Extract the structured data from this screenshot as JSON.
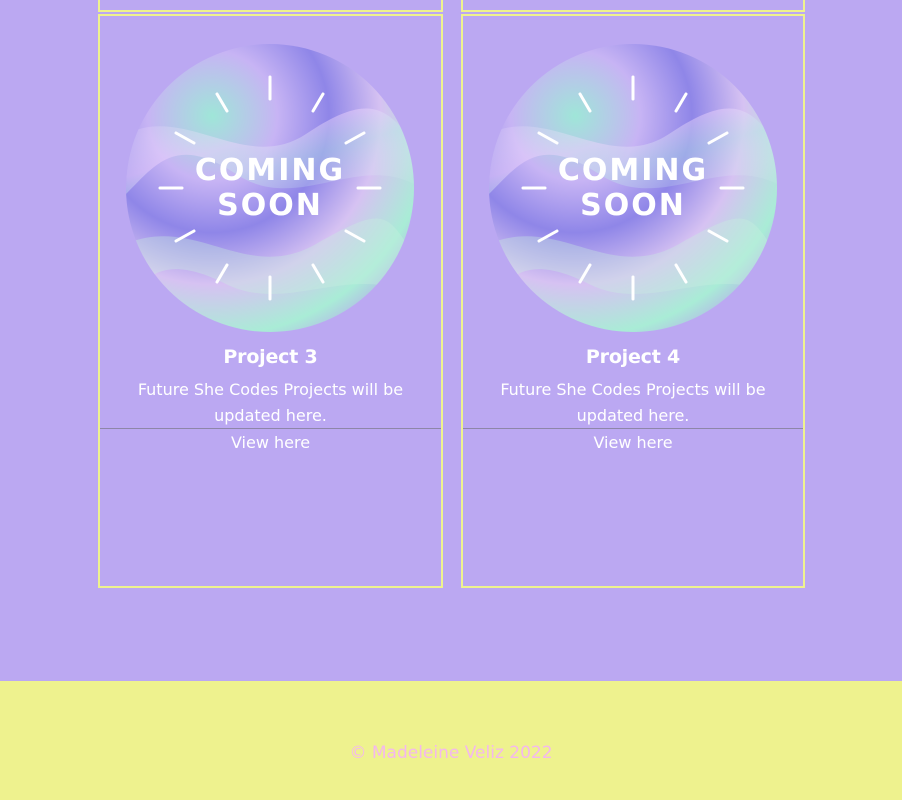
{
  "colors": {
    "background": "#bba8f2",
    "card_border": "#eef28e",
    "footer_background": "#eef28e",
    "footer_text": "#f4b8ee",
    "text": "#ffffff"
  },
  "projects": [
    {
      "image_text_line1": "COMING",
      "image_text_line2": "SOON",
      "title": "Project 3",
      "description": "Future She Codes Projects will be updated here.",
      "link_label": "View here"
    },
    {
      "image_text_line1": "COMING",
      "image_text_line2": "SOON",
      "title": "Project 4",
      "description": "Future She Codes Projects will be updated here.",
      "link_label": "View here"
    }
  ],
  "footer": {
    "copyright": "© Madeleine Veliz 2022"
  }
}
